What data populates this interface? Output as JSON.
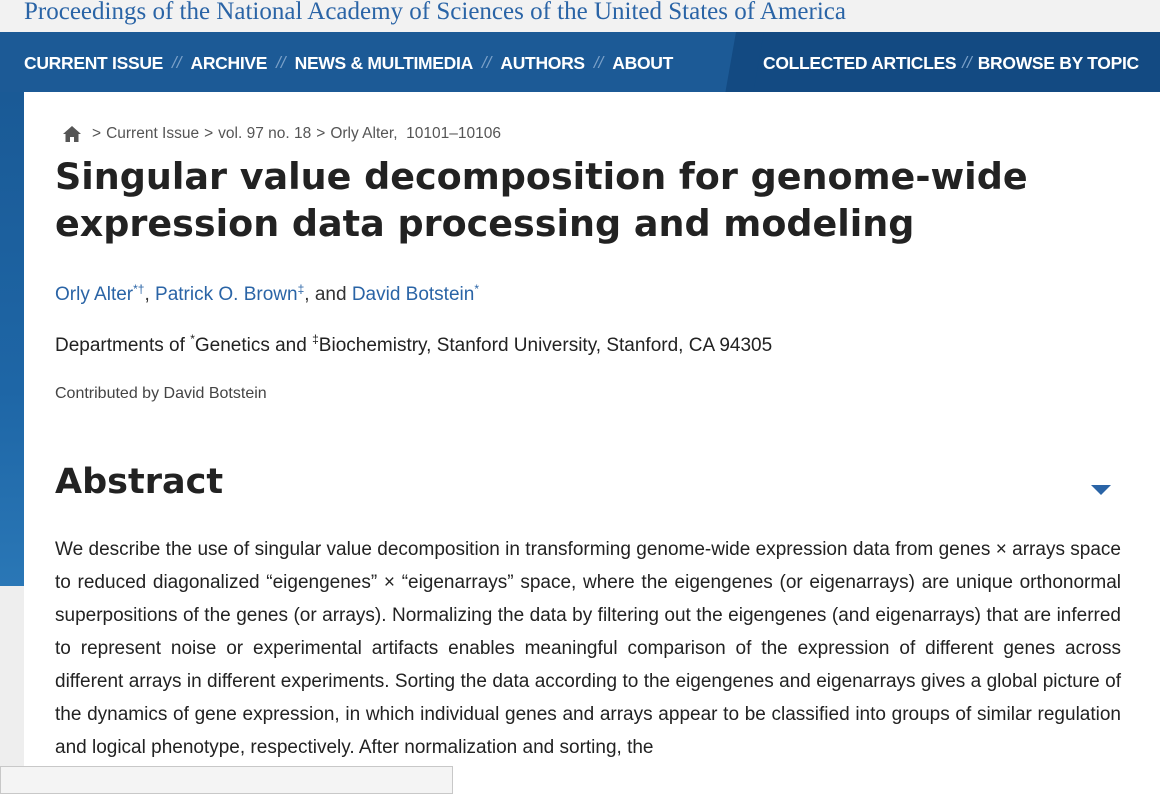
{
  "header": {
    "journal_title": "Proceedings of the National Academy of Sciences of the United States of America"
  },
  "nav": {
    "items": [
      "CURRENT ISSUE",
      "ARCHIVE",
      "NEWS & MULTIMEDIA",
      "AUTHORS",
      "ABOUT"
    ],
    "right_items": [
      "COLLECTED ARTICLES",
      "BROWSE BY TOPIC"
    ],
    "separator": "//"
  },
  "breadcrumb": {
    "home_icon": "home-icon",
    "separator": ">",
    "current_issue": "Current Issue",
    "volume": "vol. 97 no. 18",
    "author_pages": "Orly Alter,  10101–10106"
  },
  "article": {
    "title": "Singular value decomposition for genome-wide expression data processing and modeling",
    "authors": [
      {
        "name": "Orly Alter",
        "marks": "*†"
      },
      {
        "name": "Patrick O. Brown",
        "marks": "‡"
      },
      {
        "name": "David Botstein",
        "marks": "*"
      }
    ],
    "author_comma": ",",
    "author_and": ", and",
    "affiliation": {
      "prefix": "Departments of",
      "mark1": "*",
      "dept1": "Genetics and",
      "mark2": "‡",
      "rest": "Biochemistry, Stanford University, Stanford, CA 94305"
    },
    "contributed": "Contributed by David Botstein"
  },
  "abstract": {
    "heading": "Abstract",
    "toggle_icon": "chevron-down-icon",
    "text": "We describe the use of singular value decomposition in transforming genome-wide expression data from genes × arrays space to reduced diagonalized “eigengenes” × “eigenarrays” space, where the eigengenes (or eigenarrays) are unique orthonormal superpositions of the genes (or arrays). Normalizing the data by filtering out the eigengenes (and eigenarrays) that are inferred to represent noise or experimental artifacts enables meaningful comparison of the expression of different genes across different arrays in different experiments. Sorting the data according to the eigengenes and eigenarrays gives a global picture of the dynamics of gene expression, in which individual genes and arrays appear to be classified into groups of similar regulation and logical phenotype, respectively. After normalization and sorting, the"
  },
  "colors": {
    "nav_bg": "#1c5a96",
    "nav_right_bg": "#134a82",
    "link": "#2a64a6",
    "text": "#222222"
  }
}
